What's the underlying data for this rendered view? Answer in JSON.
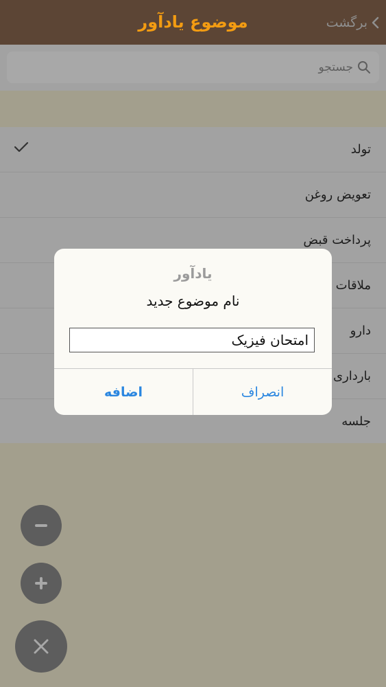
{
  "navbar": {
    "title": "موضوع یادآور",
    "back_label": "برگشت"
  },
  "search": {
    "placeholder": "جستجو"
  },
  "list": {
    "items": [
      {
        "label": "تولد",
        "checked": true
      },
      {
        "label": "تعویض روغن",
        "checked": false
      },
      {
        "label": "پرداخت قبض",
        "checked": false
      },
      {
        "label": "ملاقات",
        "checked": false
      },
      {
        "label": "دارو",
        "checked": false
      },
      {
        "label": "بارداری",
        "checked": false
      },
      {
        "label": "جلسه",
        "checked": false
      }
    ]
  },
  "dialog": {
    "title": "یادآور",
    "message": "نام موضوع جدید",
    "input_value": "امتحان فیزیک",
    "cancel_label": "انصراف",
    "add_label": "اضافه"
  },
  "fabs": {
    "minus_icon": "minus-icon",
    "plus_icon": "plus-icon",
    "close_icon": "close-icon"
  },
  "colors": {
    "title": "#f39c12",
    "navbar": "#5c4535",
    "accent": "#2a86e0",
    "fab": "#5d5d5d"
  }
}
